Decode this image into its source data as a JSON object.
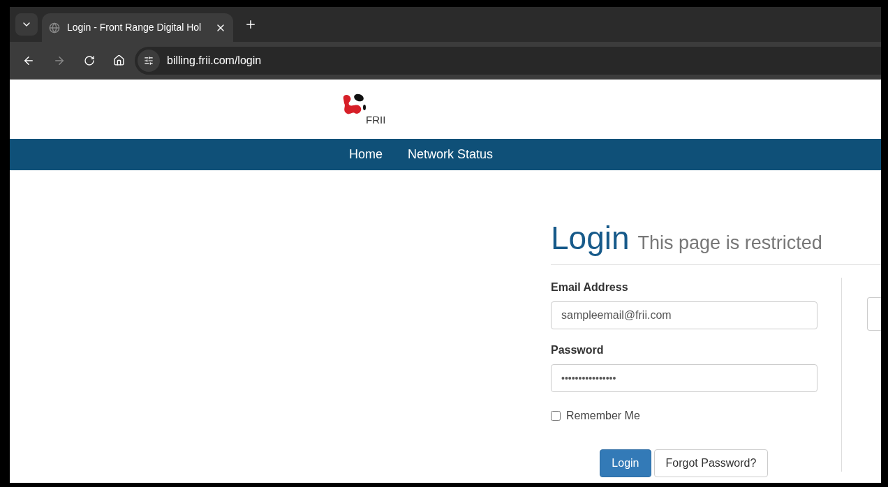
{
  "browser": {
    "tab": {
      "title": "Login - Front Range Digital Hol",
      "selected": true
    },
    "url": "billing.frii.com/login"
  },
  "logo": {
    "text": "FRII"
  },
  "nav": [
    {
      "label": "Home"
    },
    {
      "label": "Network Status"
    }
  ],
  "login": {
    "title": "Login",
    "subtitle": "This page is restricted",
    "email": {
      "label": "Email Address",
      "value": "sampleemail@frii.com"
    },
    "password": {
      "label": "Password",
      "value": "••••••••••••••••"
    },
    "remember": {
      "label": "Remember Me",
      "checked": false
    },
    "buttons": [
      {
        "label": "Login",
        "kind": "primary"
      },
      {
        "label": "Forgot Password?",
        "kind": "default"
      }
    ]
  }
}
